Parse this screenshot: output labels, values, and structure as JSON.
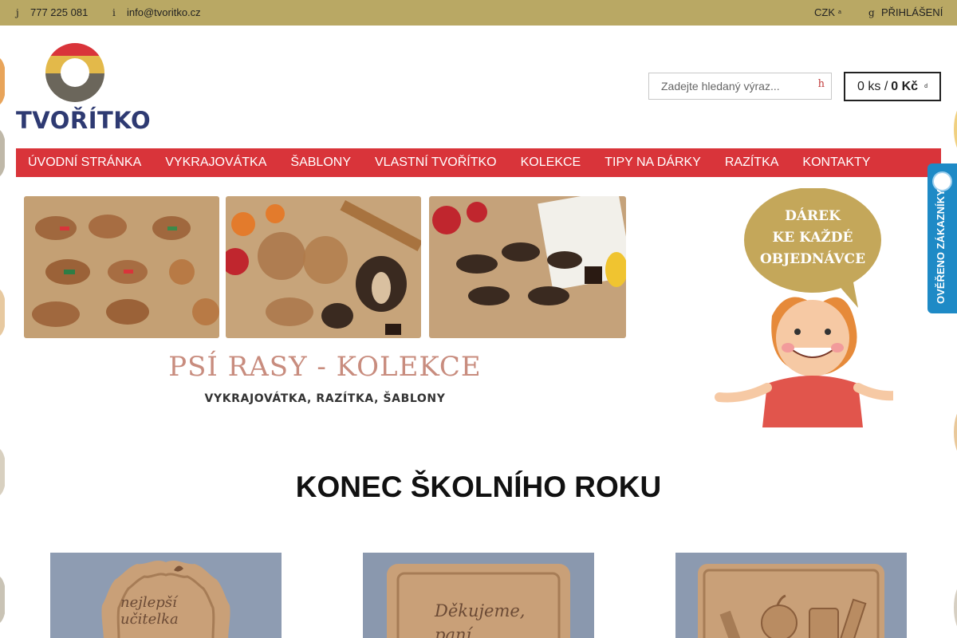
{
  "topbar": {
    "phone_icon": "j",
    "phone": "777 225 081",
    "email_icon": "i",
    "email": "info@tvoritko.cz",
    "currency": "CZK",
    "currency_caret": "a",
    "login_icon": "g",
    "login": "PŘIHLÁŠENÍ"
  },
  "header": {
    "logo_text": "TVOŘÍTKO",
    "search_placeholder": "Zadejte hledaný výraz...",
    "search_icon_glyph": "h",
    "cart_count": "0 ks /",
    "cart_total": "0 Kč",
    "cart_caret": "d"
  },
  "nav": {
    "items": [
      "ÚVODNÍ STRÁNKA",
      "VYKRAJOVÁTKA",
      "ŠABLONY",
      "VLASTNÍ TVOŘÍTKO",
      "KOLEKCE",
      "TIPY NA DÁRKY",
      "RAZÍTKA",
      "KONTAKTY"
    ]
  },
  "banner": {
    "title": "PSÍ RASY - KOLEKCE",
    "subtitle": "VYKRAJOVÁTKA, RAZÍTKA, ŠABLONY",
    "gift_line1": "DÁREK",
    "gift_line2": "KE KAŽDÉ",
    "gift_line3": "OBJEDNÁVCE"
  },
  "badge": {
    "text": "OVĚŘENO ZÁKAZNÍKY"
  },
  "section": {
    "title": "KONEC ŠKOLNÍHO ROKU"
  },
  "products": {
    "p1_text": "nejlepší učitelka",
    "p2_text": "Děkujeme, paní"
  },
  "colors": {
    "topbar": "#b9a864",
    "nav": "#d9343a",
    "logo_text": "#2e3a72",
    "badge": "#1e8ac6"
  }
}
